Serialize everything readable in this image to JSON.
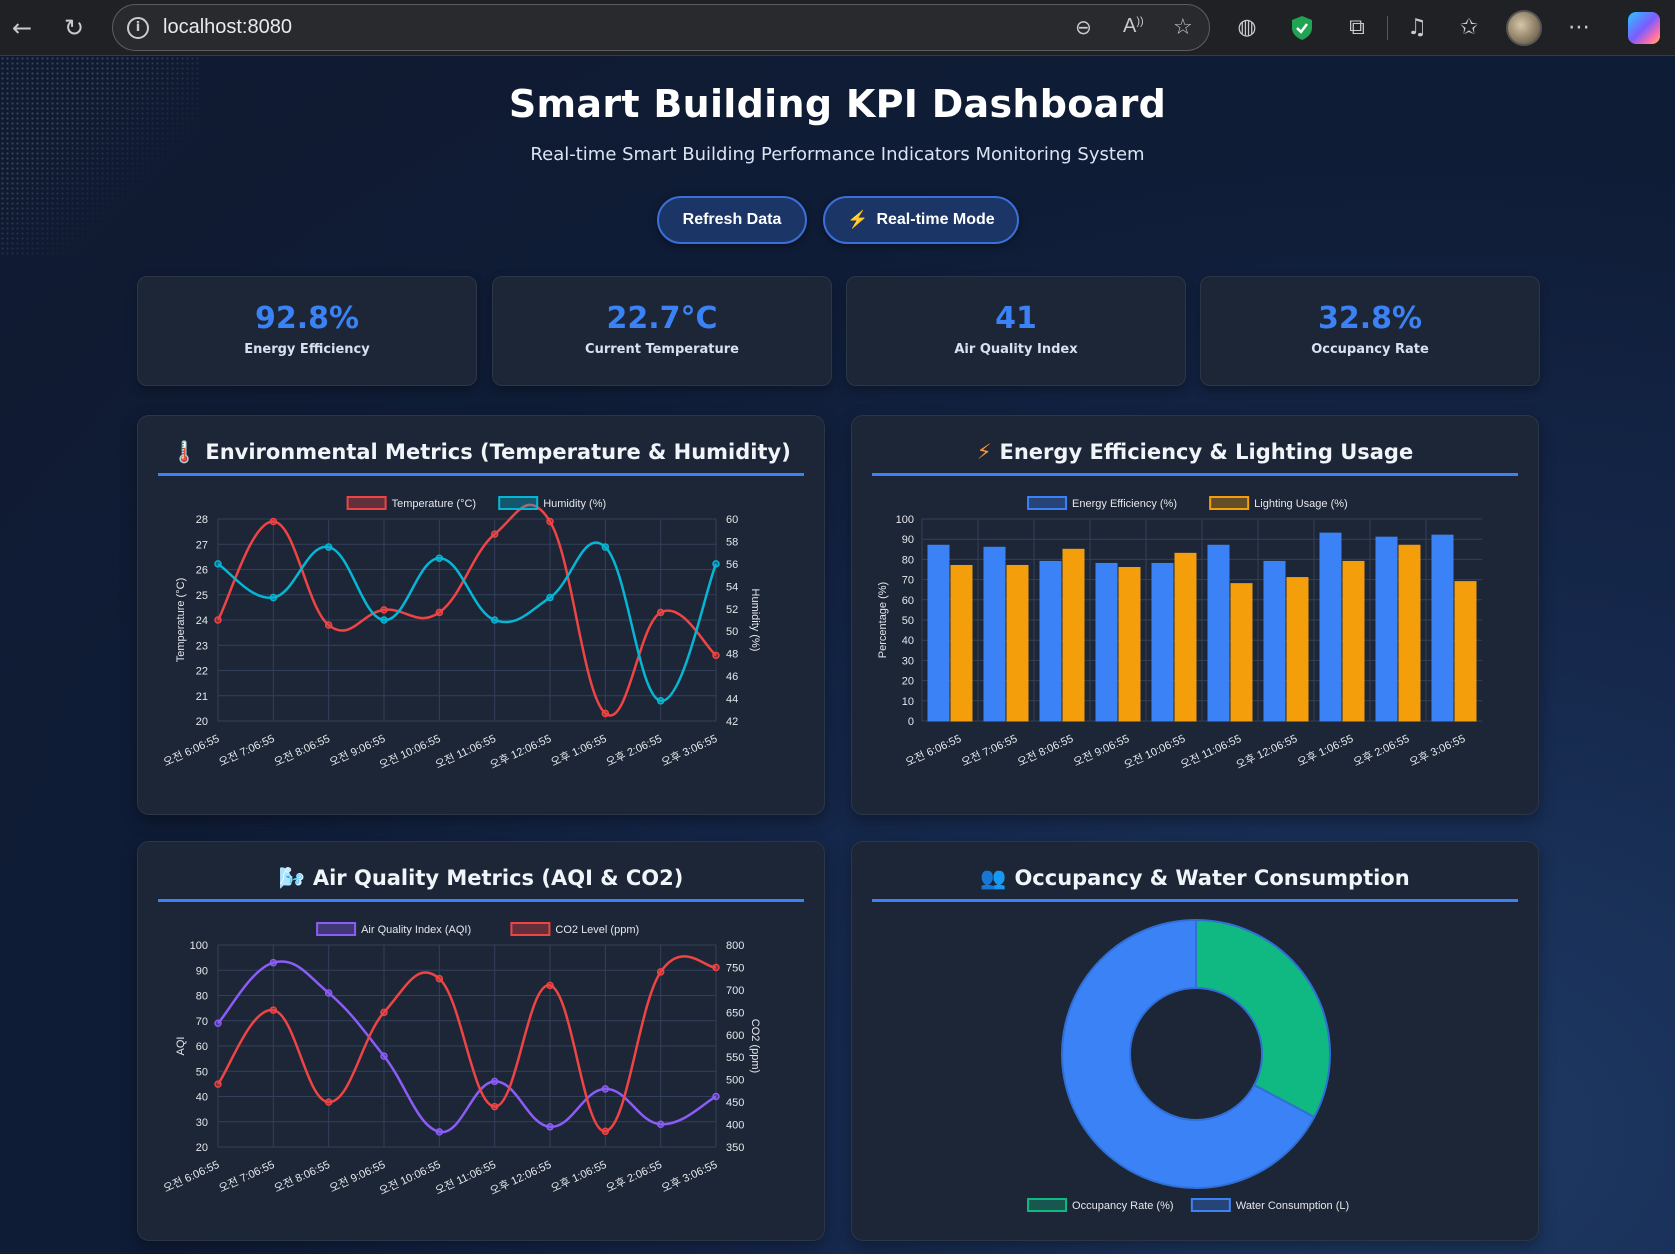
{
  "browser": {
    "url": "localhost:8080",
    "icons": [
      "back-icon",
      "refresh-icon",
      "info-icon",
      "zoom-out-icon",
      "read-aloud-icon",
      "favorite-star-icon",
      "globe-icon",
      "shield-icon",
      "extensions-icon",
      "media-icon",
      "favorites-icon",
      "more-icon",
      "copilot-icon"
    ]
  },
  "header": {
    "title": "Smart Building KPI Dashboard",
    "subtitle": "Real-time Smart Building Performance Indicators Monitoring System"
  },
  "buttons": {
    "refresh": "Refresh Data",
    "realtime": "Real-time Mode",
    "realtime_icon": "⚡"
  },
  "kpis": [
    {
      "value": "92.8%",
      "label": "Energy Efficiency"
    },
    {
      "value": "22.7°C",
      "label": "Current Temperature"
    },
    {
      "value": "41",
      "label": "Air Quality Index"
    },
    {
      "value": "32.8%",
      "label": "Occupancy Rate"
    }
  ],
  "cards": {
    "env": {
      "icon": "🌡️",
      "title": "Environmental Metrics (Temperature & Humidity)"
    },
    "energy": {
      "icon": "⚡",
      "title": "Energy Efficiency & Lighting Usage"
    },
    "air": {
      "icon": "🌬️",
      "title": "Air Quality Metrics (AQI & CO2)"
    },
    "occ": {
      "icon": "👥",
      "title": "Occupancy & Water Consumption"
    }
  },
  "colors": {
    "accent": "#3b82f6",
    "red": "#ef4444",
    "cyan": "#06b6d4",
    "orange": "#f59e0b",
    "purple": "#8b5cf6",
    "green": "#10b981"
  },
  "chart_data": [
    {
      "type": "line",
      "x": [
        "오전 6:06:55",
        "오전 7:06:55",
        "오전 8:06:55",
        "오전 9:06:55",
        "오전 10:06:55",
        "오전 11:06:55",
        "오후 12:06:55",
        "오후 1:06:55",
        "오후 2:06:55",
        "오후 3:06:55"
      ],
      "series": [
        {
          "name": "Temperature (°C)",
          "axis": "left",
          "values": [
            24.0,
            27.9,
            23.8,
            24.4,
            24.3,
            27.4,
            27.9,
            20.3,
            24.3,
            22.6
          ]
        },
        {
          "name": "Humidity (%)",
          "axis": "right",
          "values": [
            56.0,
            53.0,
            57.5,
            51.0,
            56.5,
            51.0,
            53.0,
            57.5,
            43.8,
            56.0
          ]
        }
      ],
      "ylabel": "Temperature (°C)",
      "y2label": "Humidity (%)",
      "ylim": [
        20,
        28
      ],
      "y2lim": [
        42,
        60
      ],
      "yticks": [
        20,
        21,
        22,
        23,
        24,
        25,
        26,
        27,
        28
      ],
      "y2ticks": [
        42,
        44,
        46,
        48,
        50,
        52,
        54,
        56,
        58,
        60
      ],
      "legend": "top",
      "grid": true
    },
    {
      "type": "bar",
      "categories": [
        "오전 6:06:55",
        "오전 7:06:55",
        "오전 8:06:55",
        "오전 9:06:55",
        "오전 10:06:55",
        "오전 11:06:55",
        "오후 12:06:55",
        "오후 1:06:55",
        "오후 2:06:55",
        "오후 3:06:55"
      ],
      "series": [
        {
          "name": "Energy Efficiency (%)",
          "values": [
            87,
            86,
            79,
            78,
            78,
            87,
            79,
            93,
            91,
            92
          ]
        },
        {
          "name": "Lighting Usage (%)",
          "values": [
            77,
            77,
            85,
            76,
            83,
            68,
            71,
            79,
            87,
            69
          ]
        }
      ],
      "ylabel": "Percentage (%)",
      "ylim": [
        0,
        100
      ],
      "yticks": [
        0,
        10,
        20,
        30,
        40,
        50,
        60,
        70,
        80,
        90,
        100
      ],
      "legend": "top",
      "grid": true
    },
    {
      "type": "line",
      "x": [
        "오전 6:06:55",
        "오전 7:06:55",
        "오전 8:06:55",
        "오전 9:06:55",
        "오전 10:06:55",
        "오전 11:06:55",
        "오후 12:06:55",
        "오후 1:06:55",
        "오후 2:06:55",
        "오후 3:06:55"
      ],
      "series": [
        {
          "name": "Air Quality Index (AQI)",
          "axis": "left",
          "values": [
            69,
            93,
            81,
            56,
            26,
            46,
            28,
            43,
            29,
            40
          ]
        },
        {
          "name": "CO2 Level (ppm)",
          "axis": "right",
          "values": [
            490,
            655,
            450,
            650,
            725,
            440,
            710,
            385,
            740,
            750
          ]
        }
      ],
      "ylabel": "AQI",
      "y2label": "CO2 (ppm)",
      "ylim": [
        20,
        100
      ],
      "y2lim": [
        350,
        800
      ],
      "yticks": [
        20,
        30,
        40,
        50,
        60,
        70,
        80,
        90,
        100
      ],
      "y2ticks": [
        350,
        400,
        450,
        500,
        550,
        600,
        650,
        700,
        750,
        800
      ],
      "legend": "top",
      "grid": true
    },
    {
      "type": "pie",
      "labels": [
        "Occupancy Rate (%)",
        "Water Consumption (L)"
      ],
      "values": [
        32.8,
        67.2
      ],
      "legend": "bottom"
    }
  ]
}
